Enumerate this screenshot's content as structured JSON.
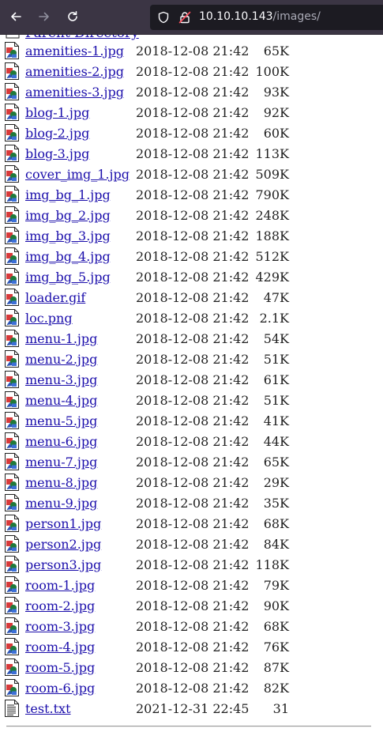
{
  "browser": {
    "url_host": "10.10.10.143",
    "url_path": "/images/"
  },
  "listing": {
    "partial_row_label": "Parent Directory",
    "files": [
      {
        "name": "amenities-1.jpg",
        "date": "2018-12-08 21:42",
        "size": "65K",
        "icon": "image-file-icon"
      },
      {
        "name": "amenities-2.jpg",
        "date": "2018-12-08 21:42",
        "size": "100K",
        "icon": "image-file-icon"
      },
      {
        "name": "amenities-3.jpg",
        "date": "2018-12-08 21:42",
        "size": "93K",
        "icon": "image-file-icon"
      },
      {
        "name": "blog-1.jpg",
        "date": "2018-12-08 21:42",
        "size": "92K",
        "icon": "image-file-icon"
      },
      {
        "name": "blog-2.jpg",
        "date": "2018-12-08 21:42",
        "size": "60K",
        "icon": "image-file-icon"
      },
      {
        "name": "blog-3.jpg",
        "date": "2018-12-08 21:42",
        "size": "113K",
        "icon": "image-file-icon"
      },
      {
        "name": "cover_img_1.jpg",
        "date": "2018-12-08 21:42",
        "size": "509K",
        "icon": "image-file-icon"
      },
      {
        "name": "img_bg_1.jpg",
        "date": "2018-12-08 21:42",
        "size": "790K",
        "icon": "image-file-icon"
      },
      {
        "name": "img_bg_2.jpg",
        "date": "2018-12-08 21:42",
        "size": "248K",
        "icon": "image-file-icon"
      },
      {
        "name": "img_bg_3.jpg",
        "date": "2018-12-08 21:42",
        "size": "188K",
        "icon": "image-file-icon"
      },
      {
        "name": "img_bg_4.jpg",
        "date": "2018-12-08 21:42",
        "size": "512K",
        "icon": "image-file-icon"
      },
      {
        "name": "img_bg_5.jpg",
        "date": "2018-12-08 21:42",
        "size": "429K",
        "icon": "image-file-icon"
      },
      {
        "name": "loader.gif",
        "date": "2018-12-08 21:42",
        "size": "47K",
        "icon": "image-file-icon"
      },
      {
        "name": "loc.png",
        "date": "2018-12-08 21:42",
        "size": "2.1K",
        "icon": "image-file-icon"
      },
      {
        "name": "menu-1.jpg",
        "date": "2018-12-08 21:42",
        "size": "54K",
        "icon": "image-file-icon"
      },
      {
        "name": "menu-2.jpg",
        "date": "2018-12-08 21:42",
        "size": "51K",
        "icon": "image-file-icon"
      },
      {
        "name": "menu-3.jpg",
        "date": "2018-12-08 21:42",
        "size": "61K",
        "icon": "image-file-icon"
      },
      {
        "name": "menu-4.jpg",
        "date": "2018-12-08 21:42",
        "size": "51K",
        "icon": "image-file-icon"
      },
      {
        "name": "menu-5.jpg",
        "date": "2018-12-08 21:42",
        "size": "41K",
        "icon": "image-file-icon"
      },
      {
        "name": "menu-6.jpg",
        "date": "2018-12-08 21:42",
        "size": "44K",
        "icon": "image-file-icon"
      },
      {
        "name": "menu-7.jpg",
        "date": "2018-12-08 21:42",
        "size": "65K",
        "icon": "image-file-icon"
      },
      {
        "name": "menu-8.jpg",
        "date": "2018-12-08 21:42",
        "size": "29K",
        "icon": "image-file-icon"
      },
      {
        "name": "menu-9.jpg",
        "date": "2018-12-08 21:42",
        "size": "35K",
        "icon": "image-file-icon"
      },
      {
        "name": "person1.jpg",
        "date": "2018-12-08 21:42",
        "size": "68K",
        "icon": "image-file-icon"
      },
      {
        "name": "person2.jpg",
        "date": "2018-12-08 21:42",
        "size": "84K",
        "icon": "image-file-icon"
      },
      {
        "name": "person3.jpg",
        "date": "2018-12-08 21:42",
        "size": "118K",
        "icon": "image-file-icon"
      },
      {
        "name": "room-1.jpg",
        "date": "2018-12-08 21:42",
        "size": "79K",
        "icon": "image-file-icon"
      },
      {
        "name": "room-2.jpg",
        "date": "2018-12-08 21:42",
        "size": "90K",
        "icon": "image-file-icon"
      },
      {
        "name": "room-3.jpg",
        "date": "2018-12-08 21:42",
        "size": "68K",
        "icon": "image-file-icon"
      },
      {
        "name": "room-4.jpg",
        "date": "2018-12-08 21:42",
        "size": "76K",
        "icon": "image-file-icon"
      },
      {
        "name": "room-5.jpg",
        "date": "2018-12-08 21:42",
        "size": "87K",
        "icon": "image-file-icon"
      },
      {
        "name": "room-6.jpg",
        "date": "2018-12-08 21:42",
        "size": "82K",
        "icon": "image-file-icon"
      },
      {
        "name": "test.txt",
        "date": "2021-12-31 22:45",
        "size": "31",
        "icon": "text-file-icon"
      }
    ]
  },
  "colors": {
    "link": "#1a0dab",
    "toolbar_bg": "#3b3544",
    "urlbar_bg": "#1c1b22"
  }
}
